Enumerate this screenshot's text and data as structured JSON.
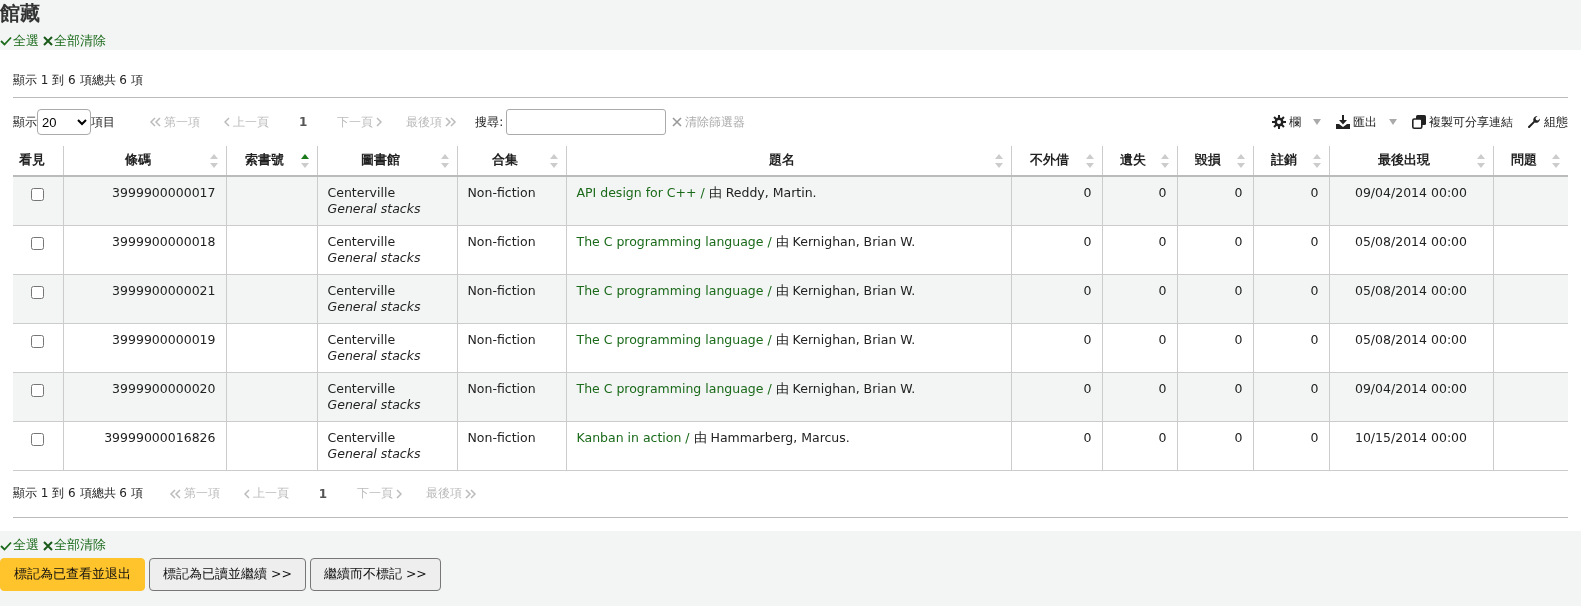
{
  "page_title": "館藏",
  "top_selection": {
    "select_all": "全選",
    "clear_all": "全部清除"
  },
  "info_top": "顯示 1 到 6 項總共 6 項",
  "length_menu": {
    "label_before": "顯示",
    "value": "20",
    "label_after": "項目"
  },
  "pager_top": [
    {
      "kind": "first",
      "label": "第一項",
      "disabled": true,
      "selected": false
    },
    {
      "kind": "prev",
      "label": "上一頁",
      "disabled": true,
      "selected": false
    },
    {
      "kind": "page",
      "label": "1",
      "disabled": false,
      "selected": true
    },
    {
      "kind": "next",
      "label": "下一頁",
      "disabled": true,
      "selected": false
    },
    {
      "kind": "last",
      "label": "最後項",
      "disabled": true,
      "selected": false
    }
  ],
  "search": {
    "label": "搜尋:"
  },
  "clear_filter": {
    "label": "清除篩選器",
    "disabled": true
  },
  "toolbar": [
    {
      "kind": "columns",
      "label": "欄",
      "dropdown": true
    },
    {
      "kind": "export",
      "label": "匯出",
      "dropdown": true
    },
    {
      "kind": "copy",
      "label": "複製可分享連結",
      "dropdown": false
    },
    {
      "kind": "configure",
      "label": "組態",
      "dropdown": false
    }
  ],
  "table": {
    "columns": [
      {
        "label": "看見",
        "sortable": false
      },
      {
        "label": "條碼",
        "sortable": true,
        "sorted_ascending": false
      },
      {
        "label": "索書號",
        "sortable": true,
        "sorted_ascending": true
      },
      {
        "label": "圖書館",
        "sortable": true,
        "sorted_ascending": false
      },
      {
        "label": "合集",
        "sortable": true,
        "sorted_ascending": false
      },
      {
        "label": "題名",
        "sortable": true,
        "sorted_ascending": false
      },
      {
        "label": "不外借",
        "sortable": true,
        "sorted_ascending": false
      },
      {
        "label": "遺失",
        "sortable": true,
        "sorted_ascending": false
      },
      {
        "label": "毀損",
        "sortable": true,
        "sorted_ascending": false
      },
      {
        "label": "註銷",
        "sortable": true,
        "sorted_ascending": false
      },
      {
        "label": "最後出現",
        "sortable": true,
        "sorted_ascending": false
      },
      {
        "label": "問題",
        "sortable": true,
        "sorted_ascending": false
      }
    ],
    "rows": [
      {
        "checked": false,
        "barcode": "3999900000017",
        "library": "Centerville",
        "location": "General stacks",
        "collection": "Non-fiction",
        "title": "API design for C++ /",
        "author": "由 Reddy, Martin.",
        "notforloan": "0",
        "lost": "0",
        "damaged": "0",
        "withdrawn": "0",
        "last_seen": "09/04/2014 00:00"
      },
      {
        "checked": false,
        "barcode": "3999900000018",
        "library": "Centerville",
        "location": "General stacks",
        "collection": "Non-fiction",
        "title": "The C programming language /",
        "author": "由 Kernighan, Brian W.",
        "notforloan": "0",
        "lost": "0",
        "damaged": "0",
        "withdrawn": "0",
        "last_seen": "05/08/2014 00:00"
      },
      {
        "checked": false,
        "barcode": "3999900000021",
        "library": "Centerville",
        "location": "General stacks",
        "collection": "Non-fiction",
        "title": "The C programming language /",
        "author": "由 Kernighan, Brian W.",
        "notforloan": "0",
        "lost": "0",
        "damaged": "0",
        "withdrawn": "0",
        "last_seen": "05/08/2014 00:00"
      },
      {
        "checked": false,
        "barcode": "3999900000019",
        "library": "Centerville",
        "location": "General stacks",
        "collection": "Non-fiction",
        "title": "The C programming language /",
        "author": "由 Kernighan, Brian W.",
        "notforloan": "0",
        "lost": "0",
        "damaged": "0",
        "withdrawn": "0",
        "last_seen": "05/08/2014 00:00"
      },
      {
        "checked": false,
        "barcode": "3999900000020",
        "library": "Centerville",
        "location": "General stacks",
        "collection": "Non-fiction",
        "title": "The C programming language /",
        "author": "由 Kernighan, Brian W.",
        "notforloan": "0",
        "lost": "0",
        "damaged": "0",
        "withdrawn": "0",
        "last_seen": "09/04/2014 00:00"
      },
      {
        "checked": false,
        "barcode": "39999000016826",
        "library": "Centerville",
        "location": "General stacks",
        "collection": "Non-fiction",
        "title": "Kanban in action /",
        "author": "由 Hammarberg, Marcus.",
        "notforloan": "0",
        "lost": "0",
        "damaged": "0",
        "withdrawn": "0",
        "last_seen": "10/15/2014 00:00"
      }
    ]
  },
  "info_bottom": "顯示 1 到 6 項總共 6 項",
  "pager_bottom": [
    {
      "kind": "first",
      "label": "第一項",
      "disabled": true,
      "selected": false
    },
    {
      "kind": "prev",
      "label": "上一頁",
      "disabled": true,
      "selected": false
    },
    {
      "kind": "page",
      "label": "1",
      "disabled": false,
      "selected": true
    },
    {
      "kind": "next",
      "label": "下一頁",
      "disabled": true,
      "selected": false
    },
    {
      "kind": "last",
      "label": "最後項",
      "disabled": true,
      "selected": false
    }
  ],
  "bottom_selection": {
    "select_all": "全選",
    "clear_all": "全部清除"
  },
  "buttons": [
    {
      "label": "標記為已查看並退出",
      "primary": true
    },
    {
      "label": "標記為已讀並繼續 >>",
      "primary": false
    },
    {
      "label": "繼續而不標記 >>",
      "primary": false
    }
  ]
}
